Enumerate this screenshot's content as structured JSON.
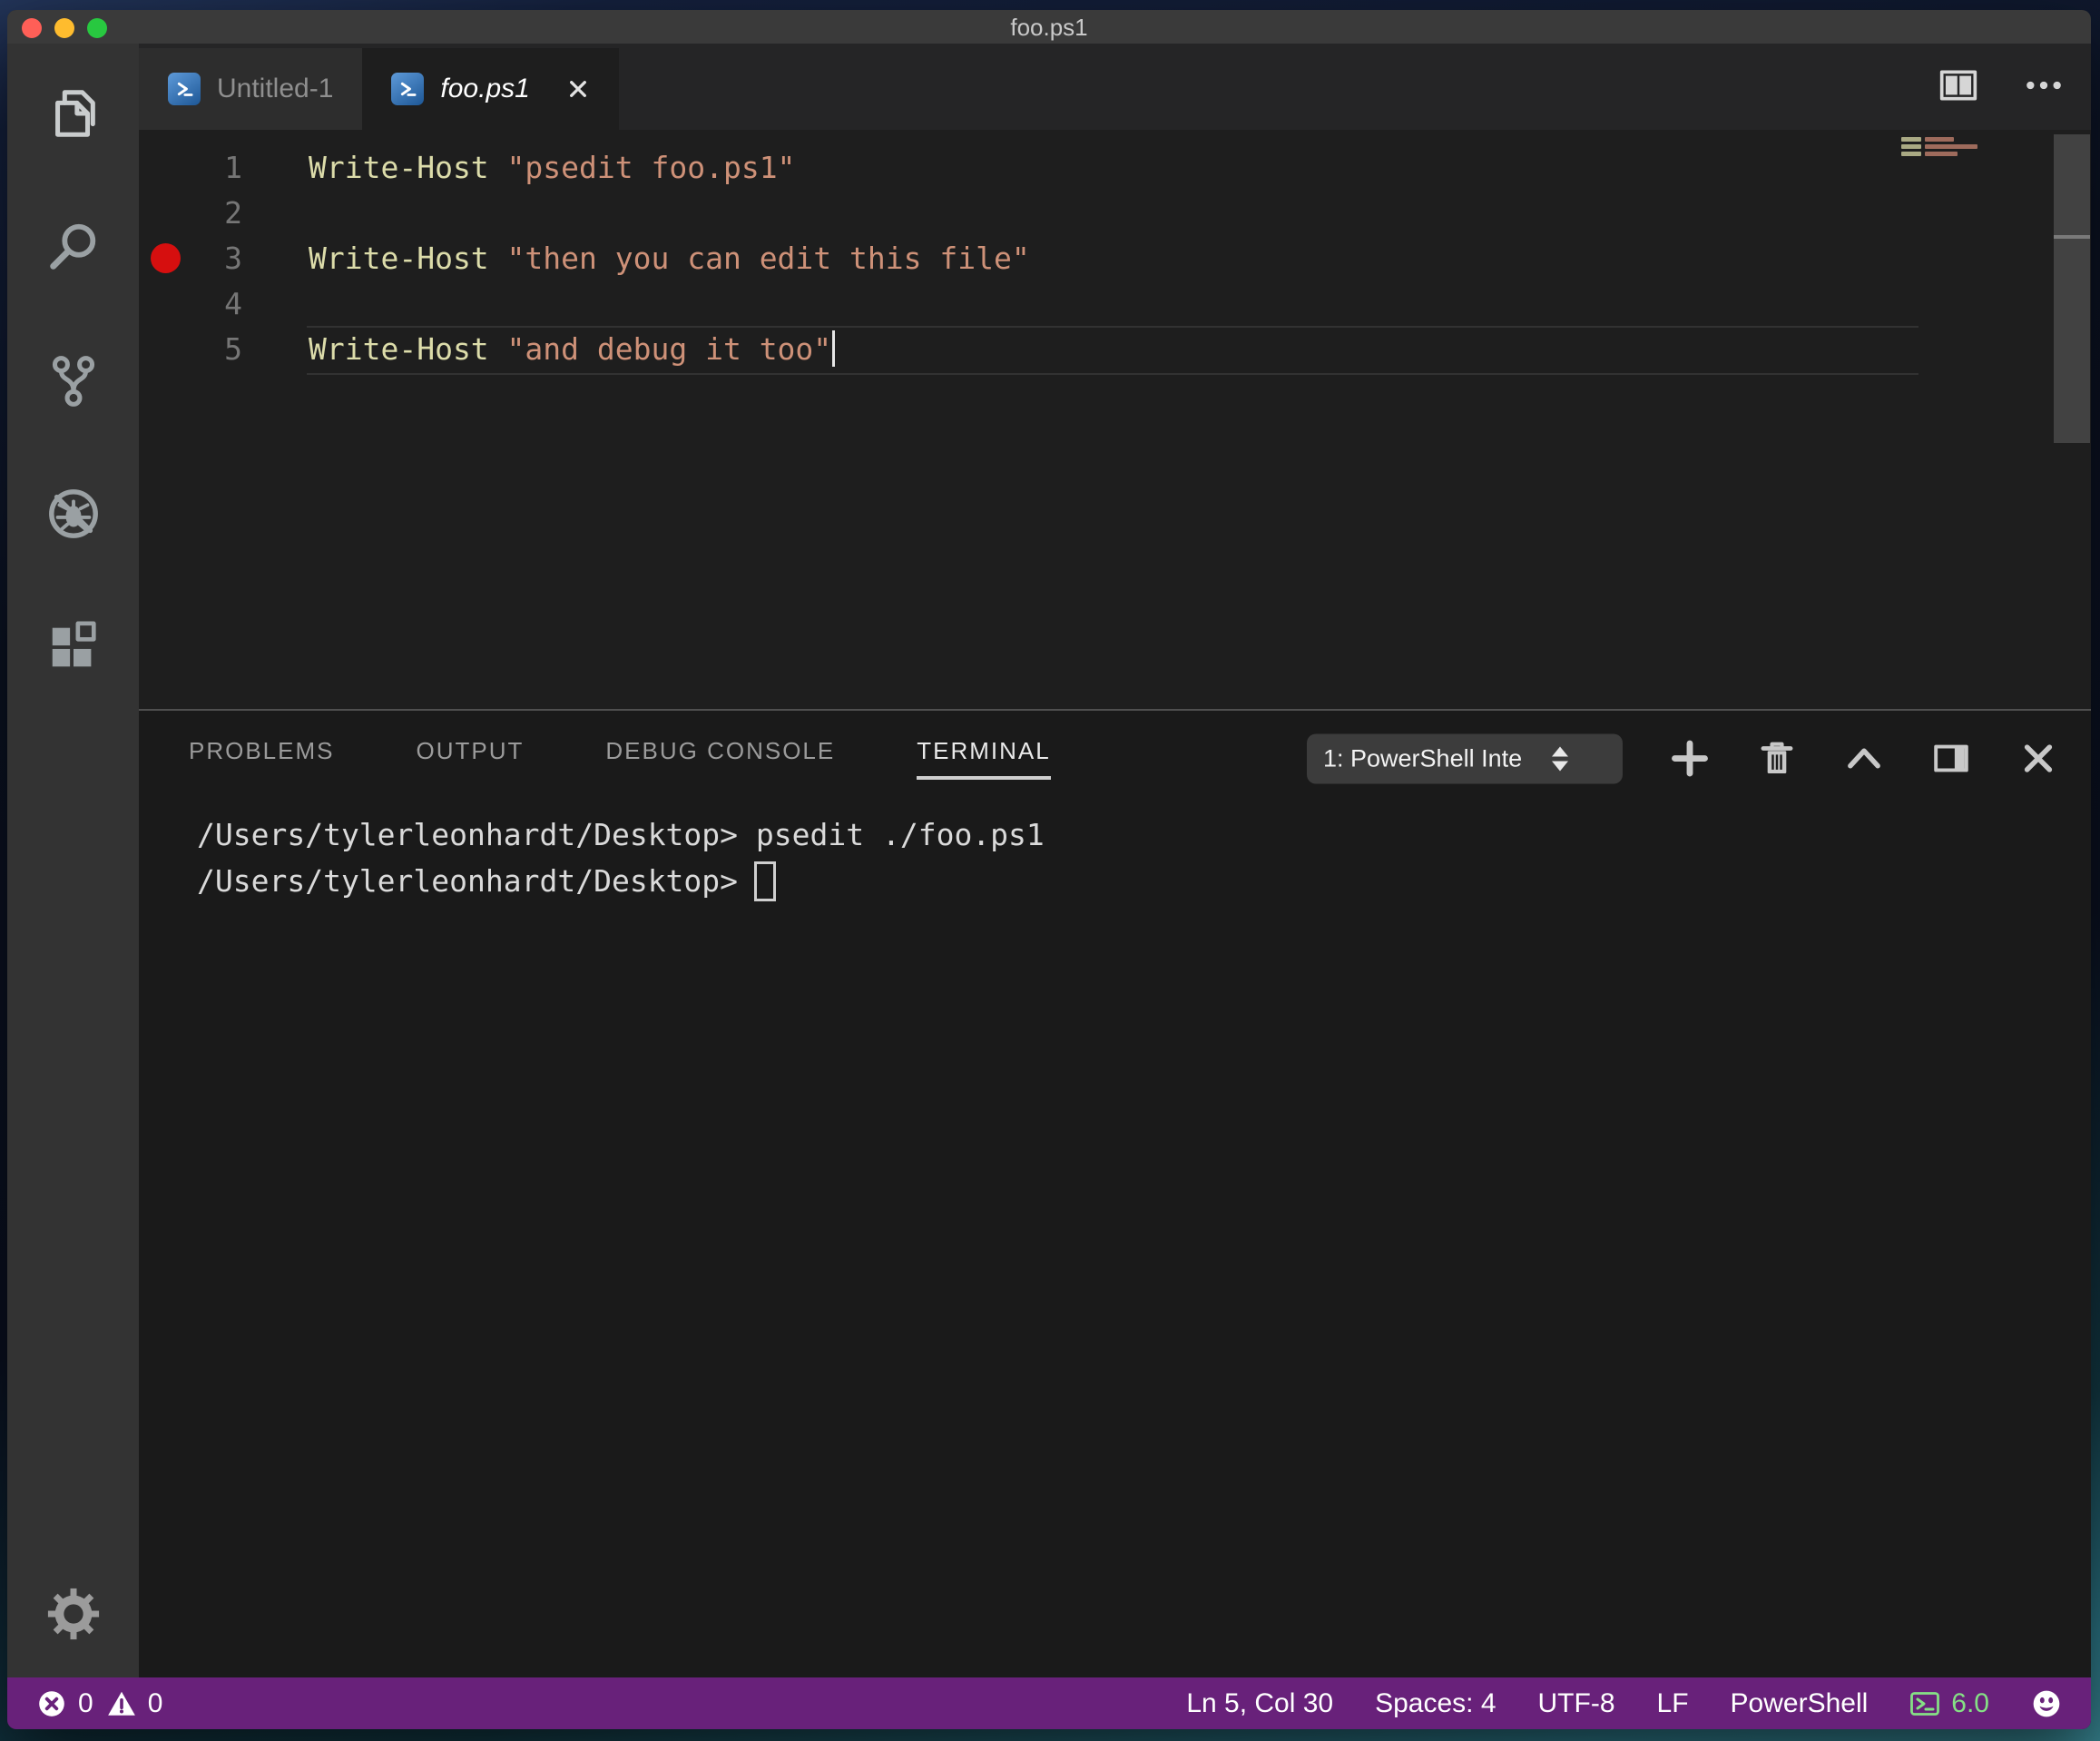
{
  "window": {
    "title": "foo.ps1"
  },
  "activity_bar": {
    "items": [
      {
        "id": "explorer",
        "icon": "files-icon"
      },
      {
        "id": "search",
        "icon": "search-icon"
      },
      {
        "id": "source-control",
        "icon": "source-control-icon"
      },
      {
        "id": "debug",
        "icon": "debug-icon"
      },
      {
        "id": "extensions",
        "icon": "extensions-icon"
      }
    ],
    "bottom": {
      "id": "settings",
      "icon": "gear-icon"
    }
  },
  "editor_tabs": [
    {
      "label": "Untitled-1",
      "icon": "powershell-icon",
      "active": false,
      "closeable": false
    },
    {
      "label": "foo.ps1",
      "icon": "powershell-icon",
      "active": true,
      "closeable": true
    }
  ],
  "editor": {
    "syntax_colors": {
      "command": "#dcdcaa",
      "string": "#ce9178"
    },
    "breakpoint_color": "#d60f0f",
    "lines": [
      {
        "number": "1",
        "breakpoint": false,
        "current": false,
        "cursor": false,
        "tokens": [
          {
            "text": "Write-Host ",
            "type": "command"
          },
          {
            "text": "\"psedit foo.ps1\"",
            "type": "string"
          }
        ]
      },
      {
        "number": "2",
        "breakpoint": false,
        "current": false,
        "cursor": false,
        "tokens": []
      },
      {
        "number": "3",
        "breakpoint": true,
        "current": false,
        "cursor": false,
        "tokens": [
          {
            "text": "Write-Host ",
            "type": "command"
          },
          {
            "text": "\"then you can edit this file\"",
            "type": "string"
          }
        ]
      },
      {
        "number": "4",
        "breakpoint": false,
        "current": false,
        "cursor": false,
        "tokens": []
      },
      {
        "number": "5",
        "breakpoint": false,
        "current": true,
        "cursor": true,
        "tokens": [
          {
            "text": "Write-Host ",
            "type": "command"
          },
          {
            "text": "\"and debug it too\"",
            "type": "string"
          }
        ]
      }
    ]
  },
  "panel": {
    "tabs": [
      {
        "label": "PROBLEMS",
        "active": false
      },
      {
        "label": "OUTPUT",
        "active": false
      },
      {
        "label": "DEBUG CONSOLE",
        "active": false
      },
      {
        "label": "TERMINAL",
        "active": true
      }
    ],
    "terminal_selector": {
      "value": "1: PowerShell Inte"
    },
    "actions": [
      {
        "id": "new-terminal",
        "icon": "plus-icon"
      },
      {
        "id": "kill-terminal",
        "icon": "trash-icon"
      },
      {
        "id": "maximize-panel",
        "icon": "chevron-up-icon"
      },
      {
        "id": "move-panel",
        "icon": "panel-right-icon"
      },
      {
        "id": "close-panel",
        "icon": "close-icon"
      }
    ],
    "terminal_lines": [
      {
        "prompt": "/Users/tylerleonhardt/Desktop>",
        "command": " psedit ./foo.ps1",
        "cursor": false
      },
      {
        "prompt": "/Users/tylerleonhardt/Desktop>",
        "command": "",
        "cursor": true
      }
    ]
  },
  "status_bar": {
    "background": "#68217a",
    "accent_green": "#85e085",
    "left": [
      {
        "id": "errors",
        "icon": "error-icon",
        "value": "0"
      },
      {
        "id": "warnings",
        "icon": "warning-icon",
        "value": "0"
      }
    ],
    "right": [
      {
        "id": "cursor-position",
        "label": "Ln 5, Col 30"
      },
      {
        "id": "indentation",
        "label": "Spaces: 4"
      },
      {
        "id": "encoding",
        "label": "UTF-8"
      },
      {
        "id": "eol",
        "label": "LF"
      },
      {
        "id": "language-mode",
        "label": "PowerShell"
      },
      {
        "id": "powershell-version",
        "label": "6.0",
        "icon": "ps-session-icon",
        "green": true
      },
      {
        "id": "feedback",
        "icon": "smiley-icon"
      }
    ]
  }
}
